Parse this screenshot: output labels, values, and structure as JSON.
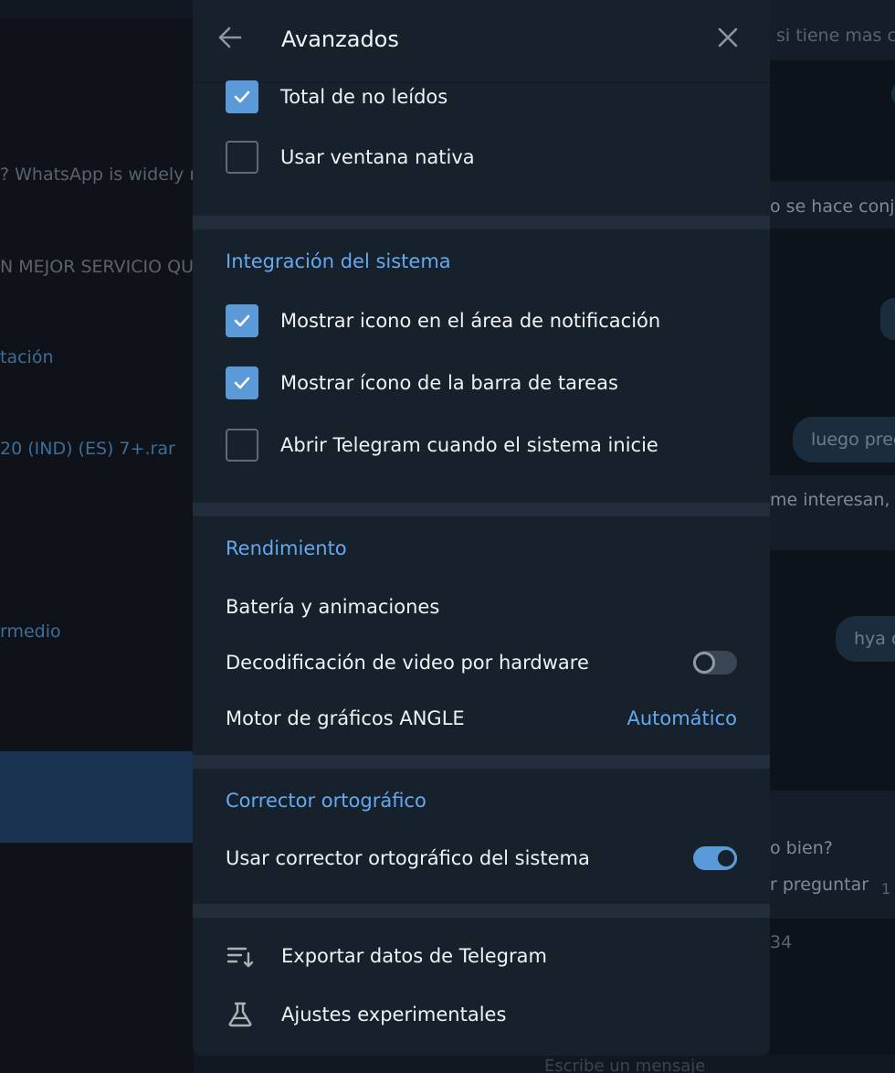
{
  "background": {
    "left_snippets": [
      "?  WhatsApp is widely r",
      "N MEJOR SERVICIO QU",
      "tación",
      "20 (IND) (ES) 7+.rar",
      "rmedio"
    ],
    "right_snippets": [
      "si tiene mas c",
      "o se hace conju",
      "me interesan, e",
      "o bien?",
      "r preguntar",
      "1",
      "34",
      "Escribe un mensaje"
    ],
    "bubbles": [
      "luego preg",
      "hya c"
    ]
  },
  "dialog": {
    "title": "Avanzados",
    "back_icon": "arrow-left-icon",
    "close_icon": "close-icon",
    "top_items": [
      {
        "label": "Total de no leídos",
        "checked": true
      },
      {
        "label": "Usar ventana nativa",
        "checked": false
      }
    ],
    "integration": {
      "title": "Integración del sistema",
      "items": [
        {
          "label": "Mostrar icono en el área de notificación",
          "checked": true
        },
        {
          "label": "Mostrar ícono de la barra de tareas",
          "checked": true
        },
        {
          "label": "Abrir Telegram cuando el sistema inicie",
          "checked": false
        }
      ]
    },
    "performance": {
      "title": "Rendimiento",
      "battery_label": "Batería y animaciones",
      "hw_decoding_label": "Decodificación de video por hardware",
      "hw_decoding_on": false,
      "angle_label": "Motor de gráficos ANGLE",
      "angle_value": "Automático"
    },
    "spellcheck": {
      "title": "Corrector ortográfico",
      "system_label": "Usar corrector ortográfico del sistema",
      "system_on": true
    },
    "actions": [
      {
        "label": "Exportar datos de Telegram",
        "icon": "export-list-icon"
      },
      {
        "label": "Ajustes experimentales",
        "icon": "flask-icon"
      }
    ]
  },
  "colors": {
    "accent": "#64a9f0",
    "checkbox_on": "#5b9ad8",
    "dialog_bg": "#17212b",
    "separator": "#232e3c"
  }
}
